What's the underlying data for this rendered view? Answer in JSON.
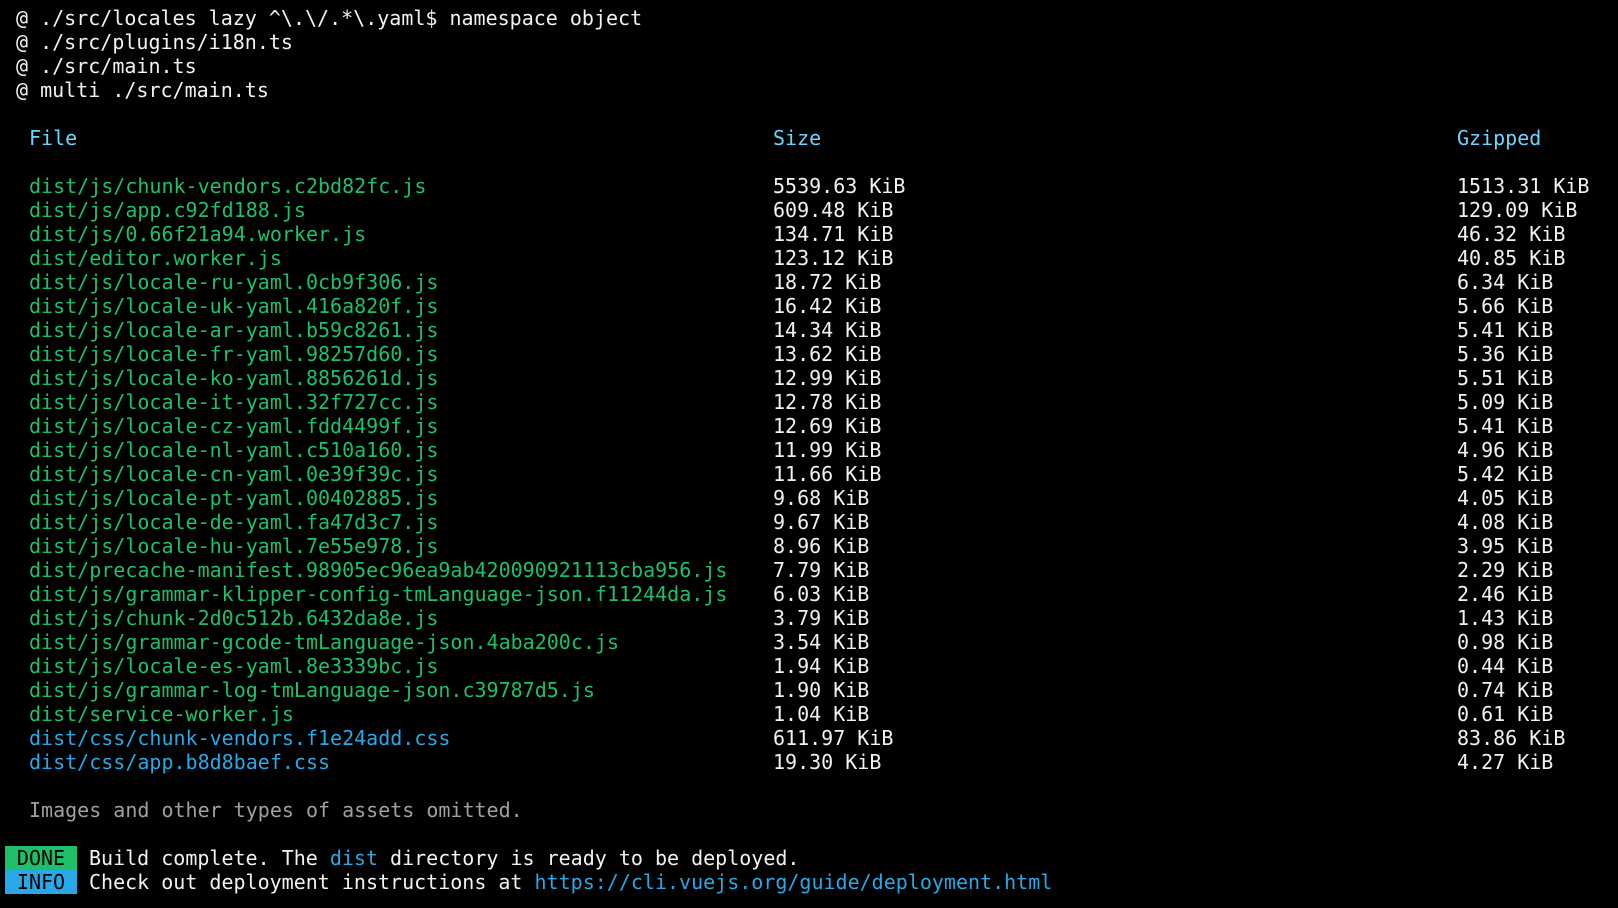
{
  "log": {
    "lines": [
      "@ ./src/locales lazy ^\\.\\/.*\\.yaml$ namespace object",
      "@ ./src/plugins/i18n.ts",
      "@ ./src/main.ts",
      "@ multi ./src/main.ts"
    ]
  },
  "table": {
    "headers": {
      "file": "File",
      "size": "Size",
      "gzipped": "Gzipped"
    },
    "rows": [
      {
        "file": "dist/js/chunk-vendors.c2bd82fc.js",
        "size": "5539.63 KiB",
        "gzipped": "1513.31 KiB",
        "type": "js"
      },
      {
        "file": "dist/js/app.c92fd188.js",
        "size": "609.48 KiB",
        "gzipped": "129.09 KiB",
        "type": "js"
      },
      {
        "file": "dist/js/0.66f21a94.worker.js",
        "size": "134.71 KiB",
        "gzipped": "46.32 KiB",
        "type": "js"
      },
      {
        "file": "dist/editor.worker.js",
        "size": "123.12 KiB",
        "gzipped": "40.85 KiB",
        "type": "js"
      },
      {
        "file": "dist/js/locale-ru-yaml.0cb9f306.js",
        "size": "18.72 KiB",
        "gzipped": "6.34 KiB",
        "type": "js"
      },
      {
        "file": "dist/js/locale-uk-yaml.416a820f.js",
        "size": "16.42 KiB",
        "gzipped": "5.66 KiB",
        "type": "js"
      },
      {
        "file": "dist/js/locale-ar-yaml.b59c8261.js",
        "size": "14.34 KiB",
        "gzipped": "5.41 KiB",
        "type": "js"
      },
      {
        "file": "dist/js/locale-fr-yaml.98257d60.js",
        "size": "13.62 KiB",
        "gzipped": "5.36 KiB",
        "type": "js"
      },
      {
        "file": "dist/js/locale-ko-yaml.8856261d.js",
        "size": "12.99 KiB",
        "gzipped": "5.51 KiB",
        "type": "js"
      },
      {
        "file": "dist/js/locale-it-yaml.32f727cc.js",
        "size": "12.78 KiB",
        "gzipped": "5.09 KiB",
        "type": "js"
      },
      {
        "file": "dist/js/locale-cz-yaml.fdd4499f.js",
        "size": "12.69 KiB",
        "gzipped": "5.41 KiB",
        "type": "js"
      },
      {
        "file": "dist/js/locale-nl-yaml.c510a160.js",
        "size": "11.99 KiB",
        "gzipped": "4.96 KiB",
        "type": "js"
      },
      {
        "file": "dist/js/locale-cn-yaml.0e39f39c.js",
        "size": "11.66 KiB",
        "gzipped": "5.42 KiB",
        "type": "js"
      },
      {
        "file": "dist/js/locale-pt-yaml.00402885.js",
        "size": "9.68 KiB",
        "gzipped": "4.05 KiB",
        "type": "js"
      },
      {
        "file": "dist/js/locale-de-yaml.fa47d3c7.js",
        "size": "9.67 KiB",
        "gzipped": "4.08 KiB",
        "type": "js"
      },
      {
        "file": "dist/js/locale-hu-yaml.7e55e978.js",
        "size": "8.96 KiB",
        "gzipped": "3.95 KiB",
        "type": "js"
      },
      {
        "file": "dist/precache-manifest.98905ec96ea9ab420090921113cba956.js",
        "size": "7.79 KiB",
        "gzipped": "2.29 KiB",
        "type": "js"
      },
      {
        "file": "dist/js/grammar-klipper-config-tmLanguage-json.f11244da.js",
        "size": "6.03 KiB",
        "gzipped": "2.46 KiB",
        "type": "js"
      },
      {
        "file": "dist/js/chunk-2d0c512b.6432da8e.js",
        "size": "3.79 KiB",
        "gzipped": "1.43 KiB",
        "type": "js"
      },
      {
        "file": "dist/js/grammar-gcode-tmLanguage-json.4aba200c.js",
        "size": "3.54 KiB",
        "gzipped": "0.98 KiB",
        "type": "js"
      },
      {
        "file": "dist/js/locale-es-yaml.8e3339bc.js",
        "size": "1.94 KiB",
        "gzipped": "0.44 KiB",
        "type": "js"
      },
      {
        "file": "dist/js/grammar-log-tmLanguage-json.c39787d5.js",
        "size": "1.90 KiB",
        "gzipped": "0.74 KiB",
        "type": "js"
      },
      {
        "file": "dist/service-worker.js",
        "size": "1.04 KiB",
        "gzipped": "0.61 KiB",
        "type": "js"
      },
      {
        "file": "dist/css/chunk-vendors.f1e24add.css",
        "size": "611.97 KiB",
        "gzipped": "83.86 KiB",
        "type": "css"
      },
      {
        "file": "dist/css/app.b8d8baef.css",
        "size": "19.30 KiB",
        "gzipped": "4.27 KiB",
        "type": "css"
      }
    ]
  },
  "note": "Images and other types of assets omitted.",
  "status": {
    "done_badge": "DONE",
    "done_text_before": "Build complete. The ",
    "done_highlight": "dist",
    "done_text_after": " directory is ready to be deployed.",
    "info_badge": "INFO",
    "info_text": "Check out deployment instructions at ",
    "info_link": "https://cli.vuejs.org/guide/deployment.html"
  },
  "colors": {
    "background": "#000000",
    "foreground": "#f2f2f2",
    "header": "#6fd3ff",
    "js_file": "#1fbf6a",
    "css_file": "#2aa7e6",
    "note": "#a0a0a0",
    "done_badge": "#1fbf6a",
    "info_badge": "#2aa7e6"
  }
}
